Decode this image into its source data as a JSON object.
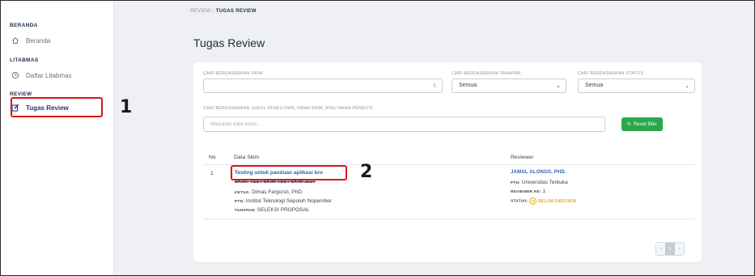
{
  "sidebar": {
    "sections": [
      {
        "title": "BERANDA",
        "items": [
          {
            "label": "Beranda",
            "icon": "home-icon"
          }
        ]
      },
      {
        "title": "LITABMAS",
        "items": [
          {
            "label": "Daftar Litabmas",
            "icon": "clock-icon"
          }
        ]
      },
      {
        "title": "REVIEW",
        "items": [
          {
            "label": "Tugas Review",
            "icon": "edit-icon",
            "active": true
          }
        ]
      }
    ]
  },
  "callouts": {
    "one": "1",
    "two": "2"
  },
  "breadcrumb": {
    "parent": "REVIEW",
    "separator": "›",
    "current": "TUGAS REVIEW"
  },
  "page_title": "Tugas Review",
  "filters": {
    "skim_label": "CARI BERDASARKAN SKIM",
    "skim_value": "",
    "tahapan_label": "CARI BERDASARKAN TAHAPAN",
    "tahapan_value": "Semua",
    "status_label": "CARI BERDASARKAN STATUS",
    "status_value": "Semua",
    "search_label": "CARI BERDASARKAN JUDUL PENELITIAN, NAMA SKIM, ATAU NAMA PENELITI",
    "search_placeholder": "Masukan kata kunci...",
    "reset_label": "Reset filter"
  },
  "table": {
    "headers": {
      "no": "No",
      "data_skim": "Data Skim",
      "reviewer": "Reviewer"
    },
    "rows": [
      {
        "no": "1",
        "title": "Testing untuk panduan aplikasi bro",
        "code": "SKIM: TEST-SKIM-TEST-SKIM 2024",
        "ketua_label": "KETUA:",
        "ketua": "Dimas Fergonzi, PhD.",
        "ptn_label": "PTN:",
        "ptn": "Institut Teknologi Sepuluh Nopember",
        "tahapan_label": "TAHAPAN:",
        "tahapan": "SELEKSI PROPOSAL",
        "reviewer_name": "JAMAL ALONSO, PHD.",
        "reviewer_ptn_label": "PTN:",
        "reviewer_ptn": "Universitas Terbuka",
        "reviewer_ke_label": "REVIEWER KE:",
        "reviewer_ke": "1",
        "status_label": "STATUS:",
        "status": "BELUM DIREVIEW",
        "status_color": "#f0a81a"
      }
    ]
  },
  "pagination": {
    "prev": "‹",
    "current": "1",
    "next": "›"
  },
  "colors": {
    "accent": "#2a62b8",
    "callout": "#d9171c",
    "reset": "#2aa84a"
  }
}
